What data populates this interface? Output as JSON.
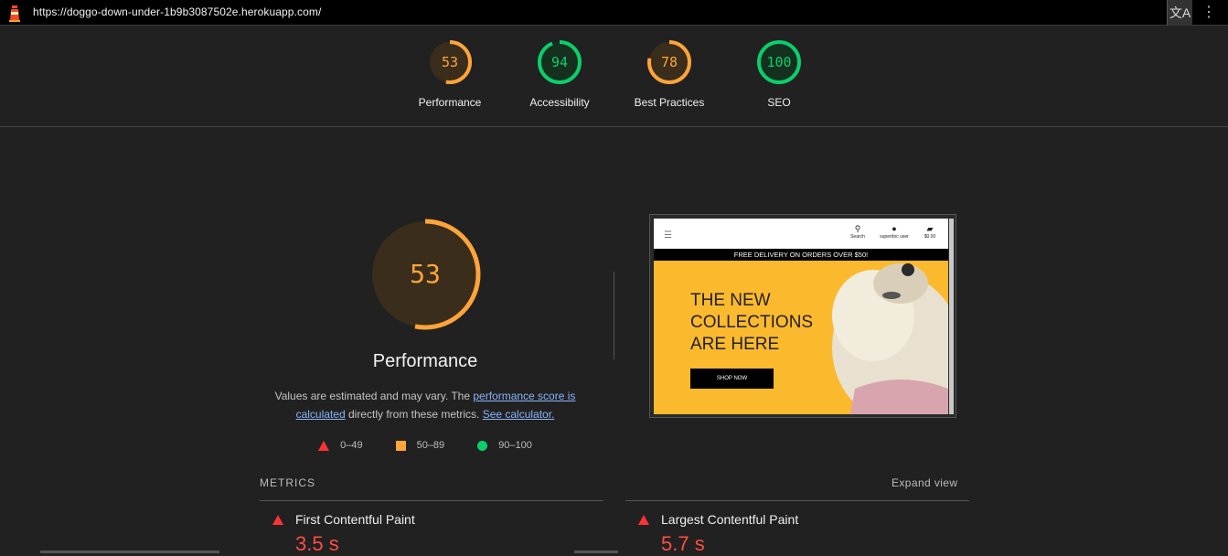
{
  "browser": {
    "url": "https://doggo-down-under-1b9b3087502e.herokuapp.com/",
    "icons": [
      "lighthouse-icon",
      "translate-icon",
      "kebab-menu-icon"
    ]
  },
  "gauges": [
    {
      "label": "Performance",
      "score": "53",
      "value": 53,
      "color": "#ffa43a"
    },
    {
      "label": "Accessibility",
      "score": "94",
      "value": 94,
      "color": "#0cce6b"
    },
    {
      "label": "Best Practices",
      "score": "78",
      "value": 78,
      "color": "#ffa43a"
    },
    {
      "label": "SEO",
      "score": "100",
      "value": 100,
      "color": "#0cce6b"
    }
  ],
  "performance": {
    "score": "53",
    "value": 53,
    "title": "Performance",
    "desc_pre": "Values are estimated and may vary. The ",
    "desc_link1": "performance score is calculated",
    "desc_mid": " directly from these metrics. ",
    "desc_link2": "See calculator.",
    "legend": [
      {
        "shape": "triangle",
        "range": "0–49",
        "color": "#ff3333"
      },
      {
        "shape": "square",
        "range": "50–89",
        "color": "#ffa43a"
      },
      {
        "shape": "circle",
        "range": "90–100",
        "color": "#0cce6b"
      }
    ]
  },
  "screenshot": {
    "nav_search": "Search",
    "nav_user": "superdoc user",
    "nav_cart": "$0.00",
    "banner": "FREE DELIVERY ON ORDERS OVER $50!",
    "hero_line1": "THE NEW",
    "hero_line2": "COLLECTIONS",
    "hero_line3": "ARE HERE",
    "cta": "SHOP NOW"
  },
  "metrics": {
    "heading": "METRICS",
    "expand": "Expand view",
    "items": [
      {
        "name": "First Contentful Paint",
        "value": "3.5 s",
        "status": "fail"
      },
      {
        "name": "Largest Contentful Paint",
        "value": "5.7 s",
        "status": "fail"
      }
    ]
  },
  "colors": {
    "bg": "#212121",
    "pass": "#0cce6b",
    "average": "#ffa43a",
    "fail": "#ff4e42",
    "link": "#8ab4f8"
  }
}
